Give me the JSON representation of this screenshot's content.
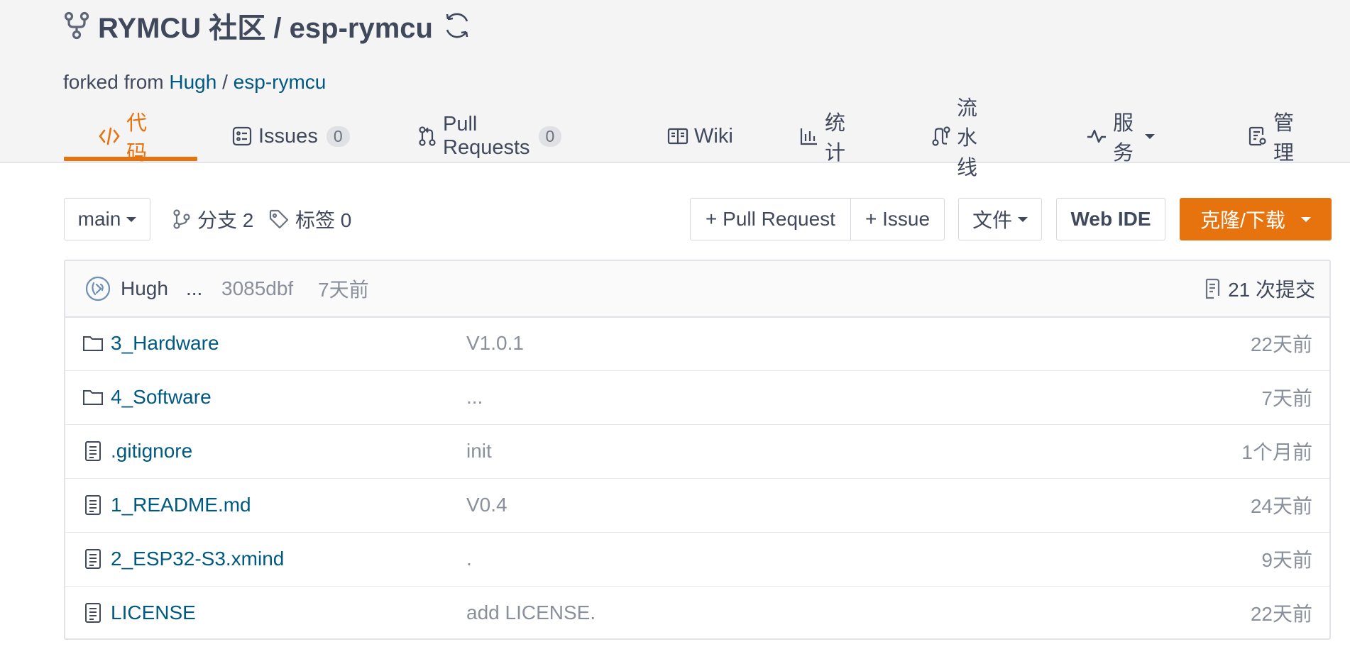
{
  "repo": {
    "owner": "RYMCU 社区",
    "separator": " / ",
    "name": "esp-rymcu"
  },
  "fork": {
    "prefix": "forked from ",
    "owner": "Hugh",
    "separator": " / ",
    "name": "esp-rymcu"
  },
  "tabs": [
    {
      "label": "代码",
      "icon": "code-icon",
      "active": true
    },
    {
      "label": "Issues",
      "icon": "issues-icon",
      "count": "0"
    },
    {
      "label": "Pull Requests",
      "icon": "pull-request-icon",
      "count": "0"
    },
    {
      "label": "Wiki",
      "icon": "book-icon"
    },
    {
      "label": "统计",
      "icon": "bar-chart-icon"
    },
    {
      "label": "流水线",
      "icon": "pipeline-icon"
    },
    {
      "label": "服务",
      "icon": "activity-icon",
      "dropdown": true
    },
    {
      "label": "管理",
      "icon": "settings-doc-icon"
    }
  ],
  "toolbar": {
    "branch": "main",
    "branches_label": "分支 2",
    "tags_label": "标签 0",
    "pull_request_button": "+ Pull Request",
    "issue_button": "+ Issue",
    "file_button": "文件",
    "web_ide_button": "Web IDE",
    "clone_button": "克隆/下载"
  },
  "last_commit": {
    "author": "Hugh",
    "message": "...",
    "sha": "3085dbf",
    "time": "7天前",
    "commits_label": "21 次提交"
  },
  "files": [
    {
      "name": "3_Hardware",
      "type": "folder",
      "message": "V1.0.1",
      "time": "22天前"
    },
    {
      "name": "4_Software",
      "type": "folder",
      "message": "...",
      "time": "7天前"
    },
    {
      "name": ".gitignore",
      "type": "file",
      "message": "init",
      "time": "1个月前"
    },
    {
      "name": "1_README.md",
      "type": "file",
      "message": "V0.4",
      "time": "24天前"
    },
    {
      "name": "2_ESP32-S3.xmind",
      "type": "file",
      "message": ".",
      "time": "9天前"
    },
    {
      "name": "LICENSE",
      "type": "file",
      "message": "add LICENSE.",
      "time": "22天前"
    }
  ],
  "colors": {
    "accent": "#e7730e",
    "link": "#005980",
    "text": "#40485b",
    "muted": "#8a909b",
    "header_bg": "#f4f4f5"
  }
}
